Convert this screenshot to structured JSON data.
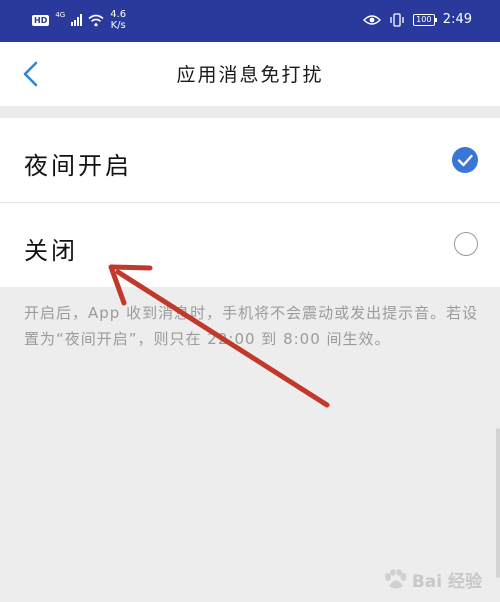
{
  "status_bar": {
    "hd": "HD",
    "network": "4G",
    "speed_value": "4.6",
    "speed_unit": "K/s",
    "battery": "100",
    "time": "2:49",
    "icons": [
      "signal-icon",
      "wifi-icon",
      "eye-icon",
      "vibrate-icon",
      "battery-icon"
    ]
  },
  "nav": {
    "title": "应用消息免打扰",
    "back_icon": "chevron-left-icon"
  },
  "options": [
    {
      "label": "夜间开启",
      "selected": true
    },
    {
      "label": "关闭",
      "selected": false
    }
  ],
  "description": "开启后，App 收到消息时，手机将不会震动或发出提示音。若设置为“夜间开启”，则只在 22:00 到 8:00 间生效。",
  "annotation": {
    "arrow_color": "#c0392b"
  },
  "watermark": {
    "text": "Bai 经验",
    "icon": "baidu-paw-icon"
  },
  "colors": {
    "status_bar": "#2a3a9c",
    "accent": "#3a75d8",
    "back_arrow": "#2f86d6"
  }
}
